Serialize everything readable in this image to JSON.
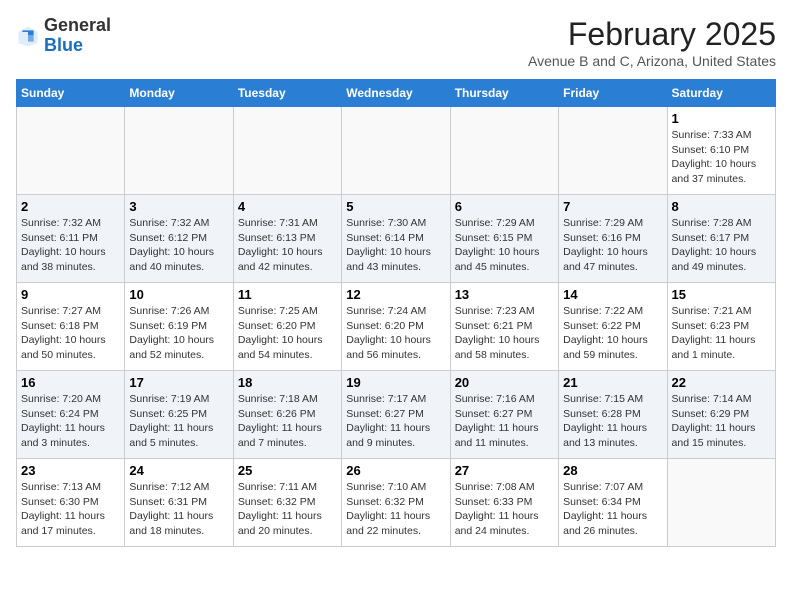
{
  "header": {
    "logo_general": "General",
    "logo_blue": "Blue",
    "month_year": "February 2025",
    "location": "Avenue B and C, Arizona, United States"
  },
  "days_of_week": [
    "Sunday",
    "Monday",
    "Tuesday",
    "Wednesday",
    "Thursday",
    "Friday",
    "Saturday"
  ],
  "weeks": [
    [
      {
        "day": "",
        "detail": ""
      },
      {
        "day": "",
        "detail": ""
      },
      {
        "day": "",
        "detail": ""
      },
      {
        "day": "",
        "detail": ""
      },
      {
        "day": "",
        "detail": ""
      },
      {
        "day": "",
        "detail": ""
      },
      {
        "day": "1",
        "detail": "Sunrise: 7:33 AM\nSunset: 6:10 PM\nDaylight: 10 hours and 37 minutes."
      }
    ],
    [
      {
        "day": "2",
        "detail": "Sunrise: 7:32 AM\nSunset: 6:11 PM\nDaylight: 10 hours and 38 minutes."
      },
      {
        "day": "3",
        "detail": "Sunrise: 7:32 AM\nSunset: 6:12 PM\nDaylight: 10 hours and 40 minutes."
      },
      {
        "day": "4",
        "detail": "Sunrise: 7:31 AM\nSunset: 6:13 PM\nDaylight: 10 hours and 42 minutes."
      },
      {
        "day": "5",
        "detail": "Sunrise: 7:30 AM\nSunset: 6:14 PM\nDaylight: 10 hours and 43 minutes."
      },
      {
        "day": "6",
        "detail": "Sunrise: 7:29 AM\nSunset: 6:15 PM\nDaylight: 10 hours and 45 minutes."
      },
      {
        "day": "7",
        "detail": "Sunrise: 7:29 AM\nSunset: 6:16 PM\nDaylight: 10 hours and 47 minutes."
      },
      {
        "day": "8",
        "detail": "Sunrise: 7:28 AM\nSunset: 6:17 PM\nDaylight: 10 hours and 49 minutes."
      }
    ],
    [
      {
        "day": "9",
        "detail": "Sunrise: 7:27 AM\nSunset: 6:18 PM\nDaylight: 10 hours and 50 minutes."
      },
      {
        "day": "10",
        "detail": "Sunrise: 7:26 AM\nSunset: 6:19 PM\nDaylight: 10 hours and 52 minutes."
      },
      {
        "day": "11",
        "detail": "Sunrise: 7:25 AM\nSunset: 6:20 PM\nDaylight: 10 hours and 54 minutes."
      },
      {
        "day": "12",
        "detail": "Sunrise: 7:24 AM\nSunset: 6:20 PM\nDaylight: 10 hours and 56 minutes."
      },
      {
        "day": "13",
        "detail": "Sunrise: 7:23 AM\nSunset: 6:21 PM\nDaylight: 10 hours and 58 minutes."
      },
      {
        "day": "14",
        "detail": "Sunrise: 7:22 AM\nSunset: 6:22 PM\nDaylight: 10 hours and 59 minutes."
      },
      {
        "day": "15",
        "detail": "Sunrise: 7:21 AM\nSunset: 6:23 PM\nDaylight: 11 hours and 1 minute."
      }
    ],
    [
      {
        "day": "16",
        "detail": "Sunrise: 7:20 AM\nSunset: 6:24 PM\nDaylight: 11 hours and 3 minutes."
      },
      {
        "day": "17",
        "detail": "Sunrise: 7:19 AM\nSunset: 6:25 PM\nDaylight: 11 hours and 5 minutes."
      },
      {
        "day": "18",
        "detail": "Sunrise: 7:18 AM\nSunset: 6:26 PM\nDaylight: 11 hours and 7 minutes."
      },
      {
        "day": "19",
        "detail": "Sunrise: 7:17 AM\nSunset: 6:27 PM\nDaylight: 11 hours and 9 minutes."
      },
      {
        "day": "20",
        "detail": "Sunrise: 7:16 AM\nSunset: 6:27 PM\nDaylight: 11 hours and 11 minutes."
      },
      {
        "day": "21",
        "detail": "Sunrise: 7:15 AM\nSunset: 6:28 PM\nDaylight: 11 hours and 13 minutes."
      },
      {
        "day": "22",
        "detail": "Sunrise: 7:14 AM\nSunset: 6:29 PM\nDaylight: 11 hours and 15 minutes."
      }
    ],
    [
      {
        "day": "23",
        "detail": "Sunrise: 7:13 AM\nSunset: 6:30 PM\nDaylight: 11 hours and 17 minutes."
      },
      {
        "day": "24",
        "detail": "Sunrise: 7:12 AM\nSunset: 6:31 PM\nDaylight: 11 hours and 18 minutes."
      },
      {
        "day": "25",
        "detail": "Sunrise: 7:11 AM\nSunset: 6:32 PM\nDaylight: 11 hours and 20 minutes."
      },
      {
        "day": "26",
        "detail": "Sunrise: 7:10 AM\nSunset: 6:32 PM\nDaylight: 11 hours and 22 minutes."
      },
      {
        "day": "27",
        "detail": "Sunrise: 7:08 AM\nSunset: 6:33 PM\nDaylight: 11 hours and 24 minutes."
      },
      {
        "day": "28",
        "detail": "Sunrise: 7:07 AM\nSunset: 6:34 PM\nDaylight: 11 hours and 26 minutes."
      },
      {
        "day": "",
        "detail": ""
      }
    ]
  ]
}
